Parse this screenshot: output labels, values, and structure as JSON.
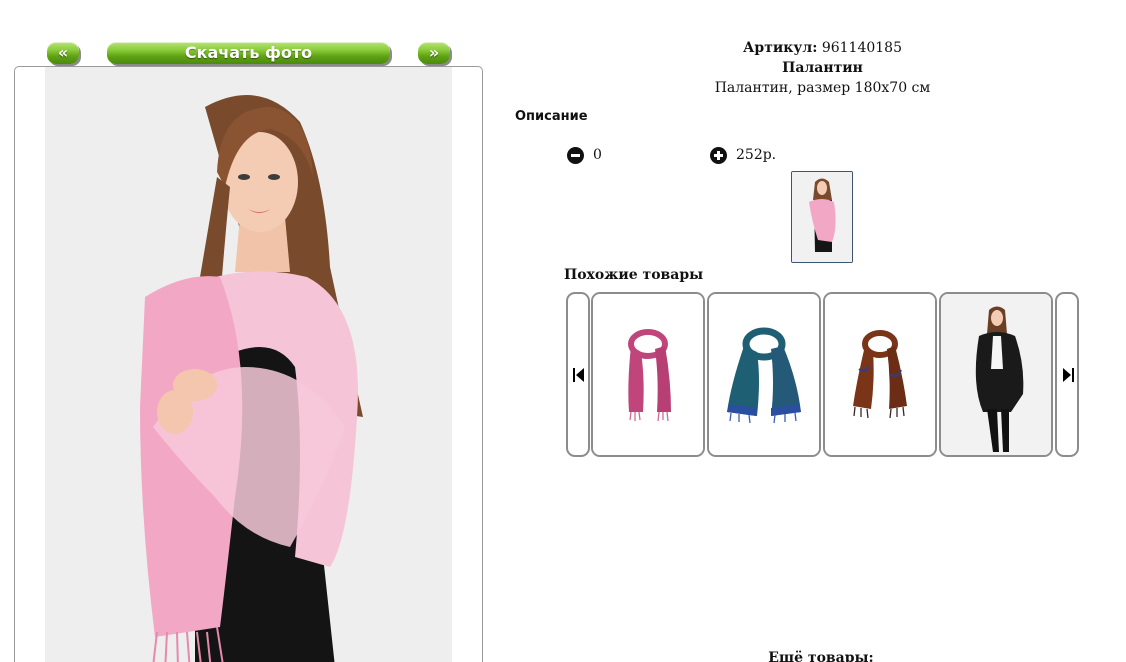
{
  "nav": {
    "prev_label": "«",
    "download_label": "Скачать фото",
    "next_label": "»"
  },
  "product": {
    "article_label": "Артикул:",
    "article_value": "961140185",
    "name": "Палантин",
    "subtitle": "Палантин, размер 180х70 см",
    "description_title": "Описание"
  },
  "cart": {
    "quantity": "0",
    "price": "252р."
  },
  "similar": {
    "title": "Похожие товары",
    "items": [
      {
        "icon": "pink-scarf",
        "color": "#c0457a"
      },
      {
        "icon": "teal-scarf",
        "color": "#1f5f74"
      },
      {
        "icon": "brown-scarf",
        "color": "#7a3418"
      },
      {
        "icon": "model-black-wrap",
        "color": "#1a1a1a"
      }
    ]
  },
  "more": {
    "title": "Ещё товары:"
  },
  "colors": {
    "accent_green": "#5fa214",
    "scarf_pink": "#f2a8c4"
  }
}
